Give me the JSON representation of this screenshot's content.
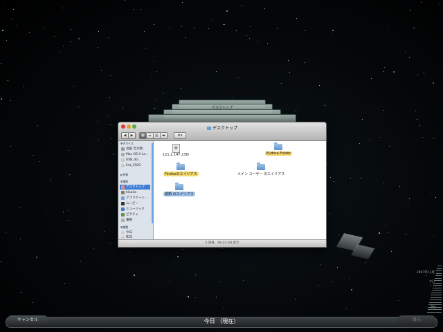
{
  "window": {
    "title": "デスクトップ",
    "status": "5 項目、99.23 GB 空き"
  },
  "stack_titles": [
    "デスクトップ"
  ],
  "sidebar": {
    "devices_head": "▼デバイス",
    "devices": [
      "池田 吉大朗",
      "Mac OS X Le...",
      "USB_4G",
      "Ext_250G"
    ],
    "shared_head": "▶共有",
    "places_head": "▼場所",
    "places": [
      "デスクトップ",
      "hikada",
      "アプリケーシ...",
      "ムービー",
      "ミュージック",
      "ピクチャ",
      "書類"
    ],
    "search_head": "▼検索",
    "search": [
      "今日",
      "昨日"
    ]
  },
  "files": [
    {
      "label": "121.1.147.236/",
      "kind": "doc"
    },
    {
      "label": "Eudora Folder",
      "kind": "folder"
    },
    {
      "label": "Firefoxのエイリアス",
      "kind": "folder"
    },
    {
      "label": "メイン ユーザー のエイリアス",
      "kind": "folder"
    },
    {
      "label": "書類 のエイリアス",
      "kind": "folder"
    }
  ],
  "bottom": {
    "cancel": "キャンセル",
    "today": "今日 （現在）",
    "restore": "復元"
  },
  "timeline": {
    "month": "2007年11月",
    "today": "今日",
    "now": "現在"
  }
}
